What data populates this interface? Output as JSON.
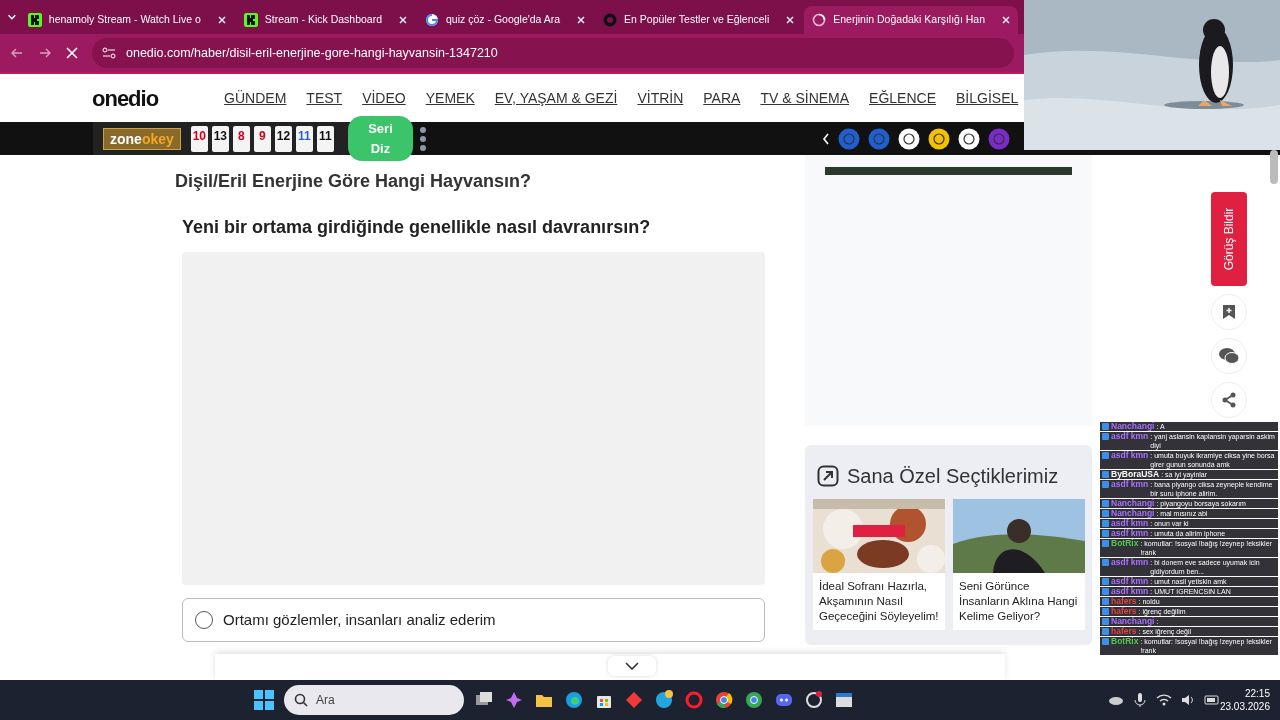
{
  "browser": {
    "tabs": [
      {
        "title": "henamoly Stream - Watch Live o",
        "kind": "kick",
        "selected": false
      },
      {
        "title": "Stream - Kick Dashboard",
        "kind": "kick",
        "selected": false
      },
      {
        "title": "quiz çöz - Google'da Ara",
        "kind": "google",
        "selected": false
      },
      {
        "title": "En Popüler Testler ve Eğlenceli",
        "kind": "site",
        "selected": false
      },
      {
        "title": "Enerjinin Doğadaki Karşılığı Han",
        "kind": "loading",
        "selected": true
      }
    ],
    "address": "onedio.com/haber/disil-eril-enerjine-gore-hangi-hayvansin-1347210"
  },
  "site": {
    "logo": "onedio",
    "menu": [
      "GÜNDEM",
      "TEST",
      "VİDEO",
      "YEMEK",
      "EV, YAŞAM & GEZİ",
      "VİTRİN",
      "PARA",
      "TV & SİNEMA",
      "EĞLENCE",
      "BİLGİSEL"
    ]
  },
  "ad_bar": {
    "brand": [
      "zone",
      "okey"
    ],
    "tiles": [
      {
        "number": "10",
        "color": "#d0021b"
      },
      {
        "number": "13",
        "color": "#111111"
      },
      {
        "number": "8",
        "color": "#d0021b"
      },
      {
        "number": "9",
        "color": "#d0021b"
      },
      {
        "number": "12",
        "color": "#111111"
      },
      {
        "number": "11",
        "color": "#2b5fd9"
      },
      {
        "number": "11",
        "color": "#111111"
      }
    ],
    "button": "Seri Diz"
  },
  "article": {
    "title": "Dişil/Eril Enerjine Göre Hangi Hayvansın?",
    "question": "Yeni bir ortama girdiğinde genellikle nasıl davranırsın?",
    "options": [
      {
        "label": "Ortamı gözlemler, insanları analiz ederim",
        "selected": false
      }
    ]
  },
  "sidebar": {
    "heading": "Sana Özel Seçtiklerimiz",
    "cards": [
      {
        "title": "İdeal Sofranı Hazırla, Akşamının Nasıl Geçeceğini Söyleyelim!"
      },
      {
        "title": "Seni Görünce İnsanların Aklına Hangi Kelime Geliyor?"
      }
    ]
  },
  "feedback_tab": "Görüş Bildir",
  "chat": [
    {
      "user": "Nanchangi",
      "text": ": A",
      "color": "#a970ff"
    },
    {
      "user": "asdf kmn",
      "text": ": yanj aslansin kaplansin yaparsin askim diyi",
      "color": "#a970ff"
    },
    {
      "user": "asdf kmn",
      "text": ": umuta buyuk ikramiye ciksa yine borsa girer gunun sonunda amk",
      "color": "#a970ff"
    },
    {
      "user": "ByBoraUSA",
      "text": ": sa iyi yayinlar",
      "color": "#ffffff"
    },
    {
      "user": "asdf kmn",
      "text": ": bana piyango ciksa zeyneple kendime bir suru iphone alirim.",
      "color": "#a970ff"
    },
    {
      "user": "Nanchangi",
      "text": ": piyangoyu borsaya sokarım",
      "color": "#a970ff"
    },
    {
      "user": "Nanchangi",
      "text": ": mal mısınız abi",
      "color": "#a970ff"
    },
    {
      "user": "asdf kmn",
      "text": ": onun var ki",
      "color": "#a970ff"
    },
    {
      "user": "asdf kmn",
      "text": ": umuta da alirim iphone",
      "color": "#a970ff"
    },
    {
      "user": "BotRix",
      "text": ": komutlar: !sosyal !bağış !zeynep !eksikler !rank",
      "color": "#53c653"
    },
    {
      "user": "asdf kmn",
      "text": ": bi donem eve sadece uyumak icin gidiyordum ben...",
      "color": "#a970ff"
    },
    {
      "user": "asdf kmn",
      "text": ": umut nasil yetiskin amk",
      "color": "#a970ff"
    },
    {
      "user": "asdf kmn",
      "text": ": UMUT IGRENCSIN LAN",
      "color": "#a970ff"
    },
    {
      "user": "hafers",
      "text": ": noldu",
      "color": "#e04545"
    },
    {
      "user": "hafers",
      "text": ": iğrenç değilim",
      "color": "#e04545"
    },
    {
      "user": "Nanchangi",
      "text": ":",
      "color": "#a970ff"
    },
    {
      "user": "hafers",
      "text": ": sex iğrenç değil",
      "color": "#e04545"
    },
    {
      "user": "BotRix",
      "text": ": komutlar: !sosyal !bağış !zeynep !eksikler !rank",
      "color": "#53c653"
    }
  ],
  "taskbar": {
    "search_placeholder": "Ara",
    "time": "22:15",
    "date": "23.03.2026"
  }
}
